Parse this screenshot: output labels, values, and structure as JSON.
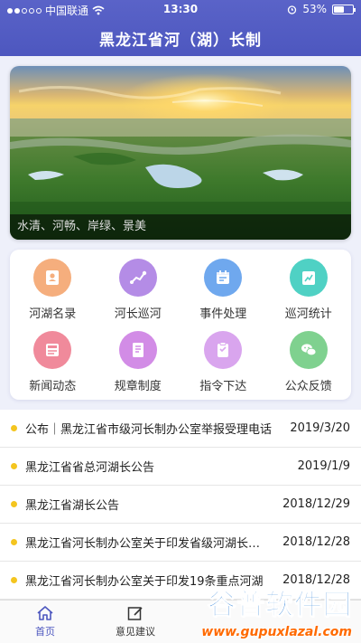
{
  "status_bar": {
    "carrier": "中国联通",
    "time": "13:30",
    "battery_text": "53%",
    "battery_level": 0.53
  },
  "header": {
    "title": "黑龙江省河（湖）长制"
  },
  "banner": {
    "caption": "水清、河畅、岸绿、景美"
  },
  "menu": [
    {
      "label": "河湖名录",
      "icon": "id-card-icon",
      "color": "#f5ae7d"
    },
    {
      "label": "河长巡河",
      "icon": "route-icon",
      "color": "#b48ce6"
    },
    {
      "label": "事件处理",
      "icon": "calendar-icon",
      "color": "#6fa8ee"
    },
    {
      "label": "巡河统计",
      "icon": "stats-icon",
      "color": "#4fd1c4"
    },
    {
      "label": "新闻动态",
      "icon": "news-icon",
      "color": "#f08a9b"
    },
    {
      "label": "规章制度",
      "icon": "book-icon",
      "color": "#d28ce6"
    },
    {
      "label": "指令下达",
      "icon": "clipboard-icon",
      "color": "#d9a5ee"
    },
    {
      "label": "公众反馈",
      "icon": "chat-icon",
      "color": "#7fd18f"
    }
  ],
  "news": [
    {
      "title": "公布｜黑龙江省市级河长制办公室举报受理电话",
      "date": "2019/3/20"
    },
    {
      "title": "黑龙江省省总河湖长公告",
      "date": "2019/1/9"
    },
    {
      "title": "黑龙江省湖长公告",
      "date": "2018/12/29"
    },
    {
      "title": "黑龙江省河长制办公室关于印发省级河湖长名单",
      "date": "2018/12/28"
    },
    {
      "title": "黑龙江省河长制办公室关于印发19条重点河湖",
      "date": "2018/12/28"
    }
  ],
  "tabs": [
    {
      "label": "首页",
      "icon": "home-icon",
      "active": true
    },
    {
      "label": "意见建议",
      "icon": "edit-icon",
      "active": false
    }
  ],
  "watermark": {
    "logo": "谷普软件园",
    "url": "www.gupuxlazal.com"
  },
  "colors": {
    "accent": "#4d57bf",
    "bullet": "#f4c51f"
  }
}
